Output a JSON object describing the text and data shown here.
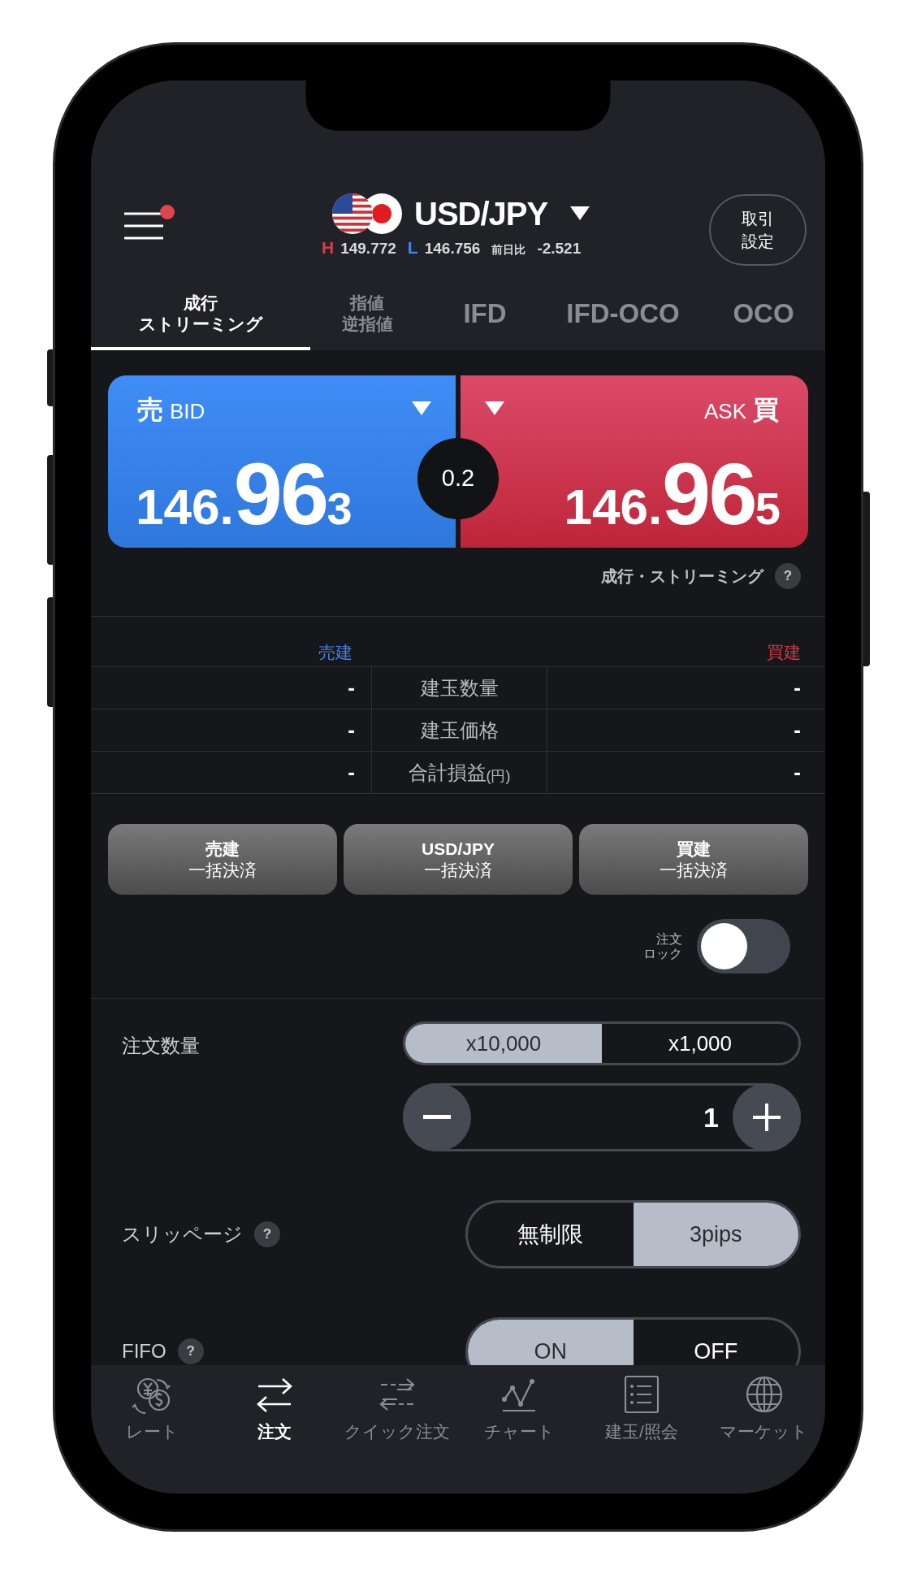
{
  "header": {
    "notification": true,
    "symbol": "USD/JPY",
    "high_label": "H",
    "high": "149.772",
    "low_label": "L",
    "low": "146.756",
    "change_label": "前日比",
    "change": "-2.521",
    "settings_button": [
      "取引",
      "設定"
    ]
  },
  "order_tabs": [
    {
      "lines": [
        "成行",
        "ストリーミング"
      ],
      "selected": true
    },
    {
      "lines": [
        "指値",
        "逆指値"
      ],
      "selected": false
    },
    {
      "lines": [
        "IFD"
      ],
      "selected": false
    },
    {
      "lines": [
        "IFD-OCO"
      ],
      "selected": false
    },
    {
      "lines": [
        "OCO"
      ],
      "selected": false
    }
  ],
  "quotes": {
    "bid": {
      "side": "売",
      "label": "BID",
      "price_head": "146.",
      "price_big": "96",
      "price_tail": "3"
    },
    "ask": {
      "side": "買",
      "label": "ASK",
      "price_head": "146.",
      "price_big": "96",
      "price_tail": "5"
    },
    "spread": "0.2"
  },
  "order_type": {
    "label": "成行・ストリーミング",
    "help": "?"
  },
  "positions": {
    "sell_header": "売建",
    "buy_header": "買建",
    "rows": [
      {
        "label": "建玉数量",
        "sell": "-",
        "buy": "-"
      },
      {
        "label": "建玉価格",
        "sell": "-",
        "buy": "-"
      },
      {
        "label": "合計損益$_{(円)}$",
        "sell": "-",
        "buy": "-"
      }
    ]
  },
  "close_buttons": [
    {
      "title": "売建",
      "subtitle": "一括決済"
    },
    {
      "title": "USD/JPY",
      "subtitle": "一括決済"
    },
    {
      "title": "買建",
      "subtitle": "一括決済"
    }
  ],
  "order_lock": {
    "label": [
      "注文",
      "ロック"
    ],
    "on": false
  },
  "quantity": {
    "label": "注文数量",
    "units": [
      {
        "label": "x10,000",
        "selected": true
      },
      {
        "label": "x1,000",
        "selected": false
      }
    ],
    "value": "1"
  },
  "slippage": {
    "label": "スリッページ",
    "help": "?",
    "options": [
      {
        "label": "無制限",
        "selected": false
      },
      {
        "label": "3pips",
        "selected": true
      }
    ]
  },
  "fifo": {
    "label": "FIFO",
    "help": "?",
    "options": [
      {
        "label": "ON",
        "selected": true
      },
      {
        "label": "OFF",
        "selected": false
      }
    ]
  },
  "nav": [
    {
      "kind": "rate",
      "label": "レート",
      "selected": false
    },
    {
      "kind": "order",
      "label": "注文",
      "selected": true
    },
    {
      "kind": "quick",
      "label": "クイック注文",
      "selected": false
    },
    {
      "kind": "chart",
      "label": "チャート",
      "selected": false
    },
    {
      "kind": "positions",
      "label": "建玉/照会",
      "selected": false
    },
    {
      "kind": "market",
      "label": "マーケット",
      "selected": false
    }
  ]
}
